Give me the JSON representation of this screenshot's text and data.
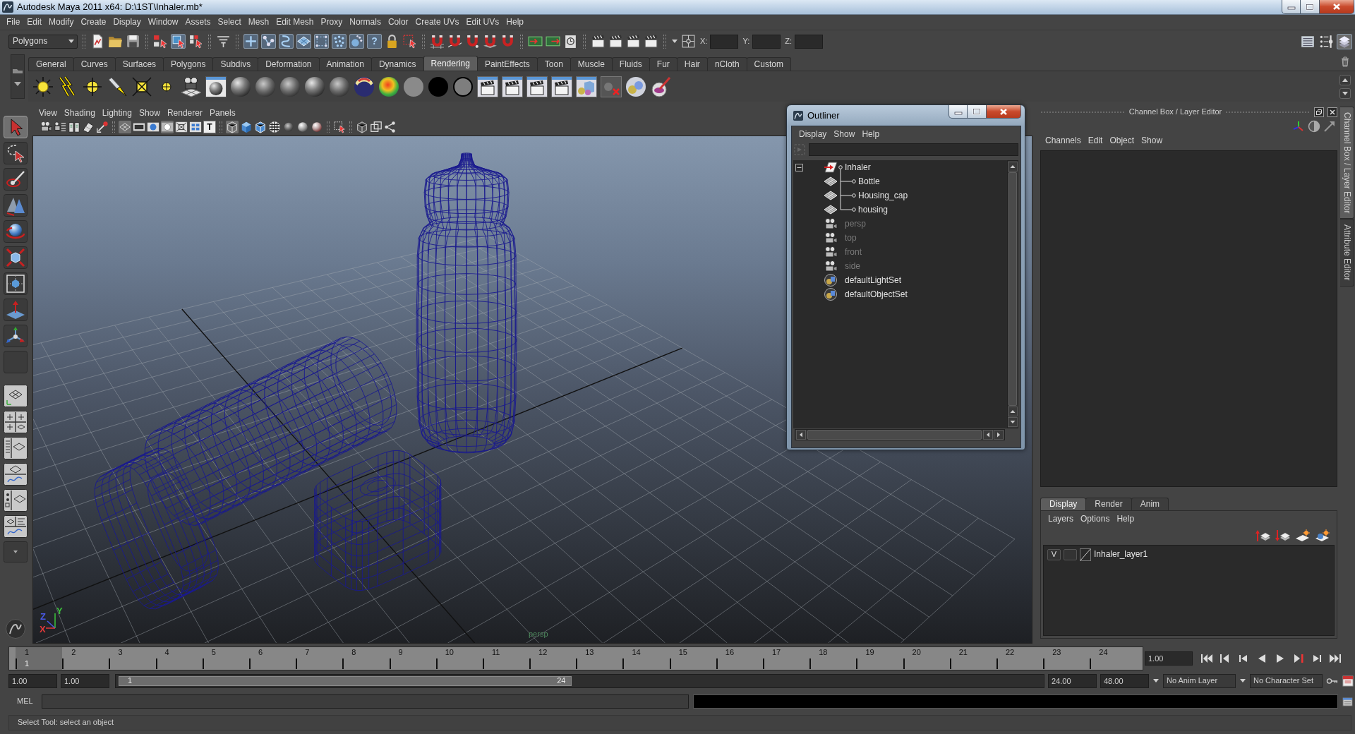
{
  "window": {
    "title": "Autodesk Maya 2011 x64: D:\\1ST\\Inhaler.mb*"
  },
  "menu_bar": [
    "File",
    "Edit",
    "Modify",
    "Create",
    "Display",
    "Window",
    "Assets",
    "Select",
    "Mesh",
    "Edit Mesh",
    "Proxy",
    "Normals",
    "Color",
    "Create UVs",
    "Edit UVs",
    "Help"
  ],
  "status_line": {
    "mode": "Polygons",
    "selection_modes": [
      {
        "selected": false
      },
      {
        "selected": true
      },
      {
        "selected": false
      }
    ],
    "selection_masks": [
      {
        "on": true
      },
      {
        "on": true
      },
      {
        "on": true
      },
      {
        "on": true
      },
      {
        "on": true
      },
      {
        "on": true
      },
      {
        "on": true
      },
      {
        "on": true,
        "symbol": "?"
      }
    ],
    "coordinate_fields": [
      {
        "label": "X:"
      },
      {
        "label": "Y:"
      },
      {
        "label": "Z:"
      }
    ],
    "editor_toggles": [
      {
        "on": false
      },
      {
        "on": false
      },
      {
        "on": true
      }
    ]
  },
  "shelf_tabs": [
    {
      "label": "General",
      "selected": false
    },
    {
      "label": "Curves",
      "selected": false
    },
    {
      "label": "Surfaces",
      "selected": false
    },
    {
      "label": "Polygons",
      "selected": false
    },
    {
      "label": "Subdivs",
      "selected": false
    },
    {
      "label": "Deformation",
      "selected": false
    },
    {
      "label": "Animation",
      "selected": false
    },
    {
      "label": "Dynamics",
      "selected": false
    },
    {
      "label": "Rendering",
      "selected": true
    },
    {
      "label": "PaintEffects",
      "selected": false
    },
    {
      "label": "Toon",
      "selected": false
    },
    {
      "label": "Muscle",
      "selected": false
    },
    {
      "label": "Fluids",
      "selected": false
    },
    {
      "label": "Fur",
      "selected": false
    },
    {
      "label": "Hair",
      "selected": false
    },
    {
      "label": "nCloth",
      "selected": false
    },
    {
      "label": "Custom",
      "selected": false
    }
  ],
  "toolbox": [
    {
      "selected": true
    },
    {
      "selected": false
    },
    {
      "selected": false
    },
    {
      "selected": false
    },
    {
      "selected": false
    },
    {
      "selected": false
    },
    {
      "selected": false
    },
    {
      "selected": false
    },
    {
      "selected": false
    }
  ],
  "viewport_panel": {
    "menu": [
      "View",
      "Shading",
      "Lighting",
      "Show",
      "Renderer",
      "Panels"
    ],
    "view_toggles": [
      {
        "on": true
      },
      {
        "on": false
      },
      {
        "on": false
      },
      {
        "on": true
      },
      {
        "on": false
      },
      {
        "on": false
      },
      {
        "on": false,
        "symbol": "T"
      },
      {
        "on": true
      },
      {
        "on": false
      },
      {
        "on": false
      },
      {
        "on": false
      },
      {
        "on": false
      },
      {
        "on": false
      },
      {
        "on": false
      },
      {
        "on": false
      }
    ],
    "axis_labels": [
      {
        "label": "Y",
        "color": "#3cc23c"
      },
      {
        "label": "Z",
        "color": "#4a5ae8"
      },
      {
        "label": "X",
        "color": "#e03a3a"
      }
    ],
    "camera_label": "persp"
  },
  "outliner": {
    "title": "Outliner",
    "menu": [
      "Display",
      "Show",
      "Help"
    ],
    "items": [
      {
        "label": "Inhaler",
        "kind": "group",
        "dimmed": false,
        "expanded": true,
        "children": [
          {
            "label": "Bottle",
            "kind": "mesh",
            "dimmed": false
          },
          {
            "label": "Housing_cap",
            "kind": "mesh",
            "dimmed": false
          },
          {
            "label": "housing",
            "kind": "mesh",
            "dimmed": false
          }
        ]
      },
      {
        "label": "persp",
        "kind": "camera",
        "dimmed": true
      },
      {
        "label": "top",
        "kind": "camera",
        "dimmed": true
      },
      {
        "label": "front",
        "kind": "camera",
        "dimmed": true
      },
      {
        "label": "side",
        "kind": "camera",
        "dimmed": true
      },
      {
        "label": "defaultLightSet",
        "kind": "set",
        "dimmed": false
      },
      {
        "label": "defaultObjectSet",
        "kind": "set",
        "dimmed": false
      }
    ]
  },
  "channel_box": {
    "title": "Channel Box / Layer Editor",
    "menu": [
      "Channels",
      "Edit",
      "Object",
      "Show"
    ],
    "layer_tabs": [
      {
        "label": "Display",
        "selected": true
      },
      {
        "label": "Render",
        "selected": false
      },
      {
        "label": "Anim",
        "selected": false
      }
    ],
    "layer_menu": [
      "Layers",
      "Options",
      "Help"
    ],
    "layers": [
      {
        "visibility": "V",
        "name": "Inhaler_layer1"
      }
    ]
  },
  "side_tabs": [
    {
      "label": "Channel Box / Layer Editor",
      "selected": true
    },
    {
      "label": "Attribute Editor",
      "selected": false
    }
  ],
  "time_slider": {
    "frames": [
      {
        "label": "1",
        "selected": true
      },
      {
        "label": "2",
        "selected": false
      },
      {
        "label": "3",
        "selected": false
      },
      {
        "label": "4",
        "selected": false
      },
      {
        "label": "5",
        "selected": false
      },
      {
        "label": "6",
        "selected": false
      },
      {
        "label": "7",
        "selected": false
      },
      {
        "label": "8",
        "selected": false
      },
      {
        "label": "9",
        "selected": false
      },
      {
        "label": "10",
        "selected": false
      },
      {
        "label": "11",
        "selected": false
      },
      {
        "label": "12",
        "selected": false
      },
      {
        "label": "13",
        "selected": false
      },
      {
        "label": "14",
        "selected": false
      },
      {
        "label": "15",
        "selected": false
      },
      {
        "label": "16",
        "selected": false
      },
      {
        "label": "17",
        "selected": false
      },
      {
        "label": "18",
        "selected": false
      },
      {
        "label": "19",
        "selected": false
      },
      {
        "label": "20",
        "selected": false
      },
      {
        "label": "21",
        "selected": false
      },
      {
        "label": "22",
        "selected": false
      },
      {
        "label": "23",
        "selected": false
      },
      {
        "label": "24",
        "selected": false
      }
    ],
    "current_frame": "1",
    "current_time": "1.00"
  },
  "range_slider": {
    "start_time": "1.00",
    "range_start": "1.00",
    "handle_start": "1",
    "handle_end": "24",
    "level": 0.49,
    "range_end": "24.00",
    "end_time": "48.00"
  },
  "anim_layer": "No Anim Layer",
  "character_set": "No Character Set",
  "command_line": {
    "language": "MEL"
  },
  "help_line": "Select Tool: select an object"
}
